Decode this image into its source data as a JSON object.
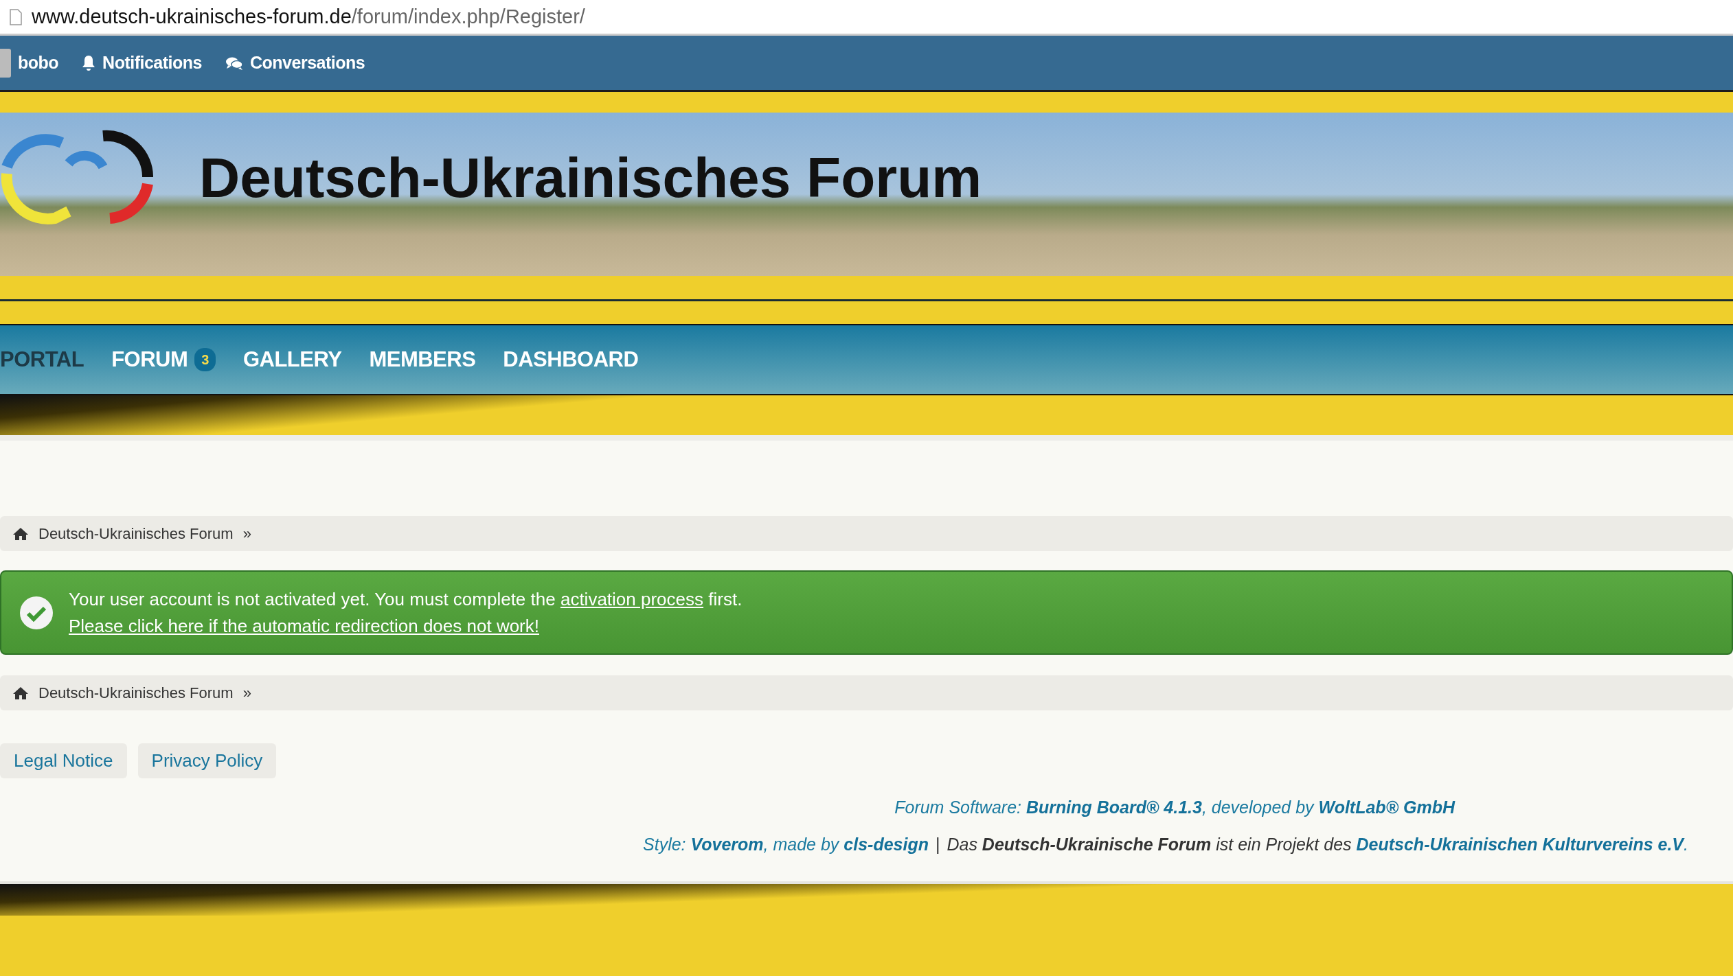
{
  "address_bar": {
    "host": "www.deutsch-ukrainisches-forum.de",
    "path": "/forum/index.php/Register/"
  },
  "user_bar": [
    {
      "kind": "user",
      "label": "bobo"
    },
    {
      "kind": "notifications",
      "label": "Notifications"
    },
    {
      "kind": "conversations",
      "label": "Conversations"
    }
  ],
  "header": {
    "title": "Deutsch-Ukrainisches Forum"
  },
  "nav": [
    {
      "label": "PORTAL",
      "selected": true
    },
    {
      "label": "FORUM",
      "selected": false,
      "badge": "3"
    },
    {
      "label": "GALLERY",
      "selected": false
    },
    {
      "label": "MEMBERS",
      "selected": false
    },
    {
      "label": "DASHBOARD",
      "selected": false
    }
  ],
  "breadcrumbs_top": [
    {
      "label": "Deutsch-Ukrainisches Forum",
      "separator": "»"
    }
  ],
  "alert": {
    "before": "Your user account is not activated yet. You must complete the ",
    "link": "activation process",
    "after": " first.",
    "redirect_link": "Please click here if the automatic redirection does not work!"
  },
  "breadcrumbs_bottom": [
    {
      "label": "Deutsch-Ukrainisches Forum",
      "separator": "»"
    }
  ],
  "footer_links": [
    "Legal Notice",
    "Privacy Policy"
  ],
  "credits": [
    [
      {
        "kind": "plain",
        "text": "Forum Software: "
      },
      {
        "kind": "link",
        "text": "Burning Board® 4.1.3"
      },
      {
        "kind": "plain",
        "text": ", developed by "
      },
      {
        "kind": "link",
        "text": "WoltLab® GmbH"
      }
    ],
    [
      {
        "kind": "plain",
        "text": "Style: "
      },
      {
        "kind": "link",
        "text": "Voverom"
      },
      {
        "kind": "plain",
        "text": ", made by "
      },
      {
        "kind": "link",
        "text": "cls-design"
      },
      {
        "kind": "separator",
        "text": "|"
      },
      {
        "kind": "dark",
        "text": "Das "
      },
      {
        "kind": "dark_bold",
        "text": "Deutsch-Ukrainische Forum"
      },
      {
        "kind": "dark",
        "text": " ist ein Projekt des "
      },
      {
        "kind": "link",
        "text": "Deutsch-Ukrainischen Kulturvereins e.V"
      },
      {
        "kind": "plain",
        "text": "."
      }
    ]
  ]
}
